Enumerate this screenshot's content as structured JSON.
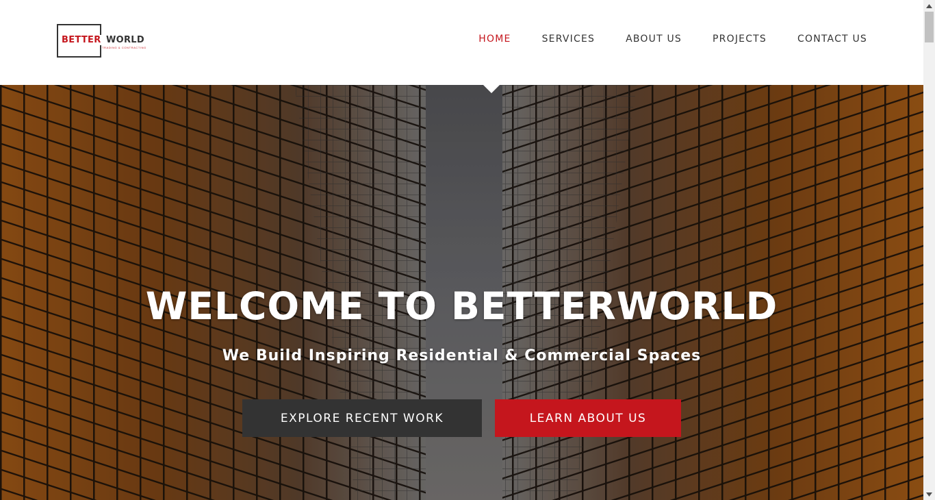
{
  "brand": {
    "logo_primary": "BETTER",
    "logo_secondary": "WORLD",
    "logo_tagline": "TRADING & CONTRACTING"
  },
  "nav": {
    "items": [
      {
        "label": "HOME",
        "active": true
      },
      {
        "label": "SERVICES",
        "active": false
      },
      {
        "label": "ABOUT US",
        "active": false
      },
      {
        "label": "PROJECTS",
        "active": false
      },
      {
        "label": "CONTACT US",
        "active": false
      }
    ]
  },
  "hero": {
    "title": "WELCOME TO BETTERWORLD",
    "subtitle": "We Build Inspiring Residential & Commercial Spaces",
    "background_image": "looking-up-between-skyscrapers",
    "primary_button": "EXPLORE RECENT WORK",
    "secondary_button": "LEARN ABOUT US"
  },
  "colors": {
    "accent": "#c5161d",
    "dark": "#333333",
    "text_on_hero": "#ffffff"
  },
  "icons": {
    "scroll_up": "scroll-up-arrow-icon",
    "scroll_down": "scroll-down-arrow-icon"
  }
}
